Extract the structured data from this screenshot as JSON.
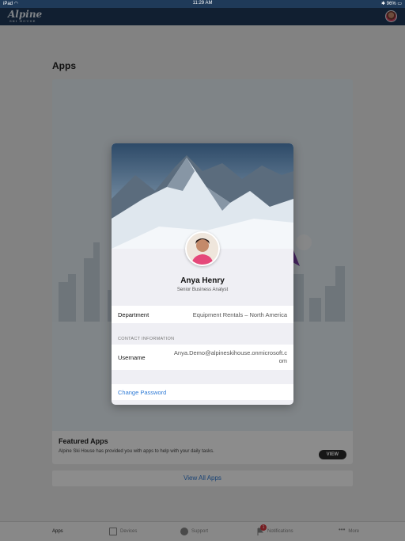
{
  "status_bar": {
    "device": "iPad",
    "time": "11:29 AM",
    "battery": "96%"
  },
  "app": {
    "logo_main": "Alpine",
    "logo_sub": "SKI HOUSE"
  },
  "page": {
    "title": "Apps"
  },
  "featured": {
    "title": "Featured Apps",
    "description": "Alpine Ski House has provided you with apps to help with your daily tasks.",
    "view_label": "VIEW"
  },
  "view_all_label": "View All Apps",
  "tabbar": {
    "items": [
      {
        "label": "Apps",
        "icon": "apps-grid-icon"
      },
      {
        "label": "Devices",
        "icon": "devices-icon"
      },
      {
        "label": "Support",
        "icon": "support-icon"
      },
      {
        "label": "Notifications",
        "icon": "flag-icon",
        "badge": "1"
      },
      {
        "label": "More",
        "icon": "more-dots-icon"
      }
    ]
  },
  "profile": {
    "name": "Anya Henry",
    "role": "Senior Business Analyst",
    "department_label": "Department",
    "department_value": "Equipment Rentals – North America",
    "contact_header": "CONTACT INFORMATION",
    "username_label": "Username",
    "username_line1": "Anya.Demo@alpineskihouse.onmicrosoft.c",
    "username_line2": "om",
    "change_password": "Change Password"
  },
  "colors": {
    "header": "#1f3a59",
    "link": "#2f7bd6",
    "badge": "#d9363e"
  }
}
